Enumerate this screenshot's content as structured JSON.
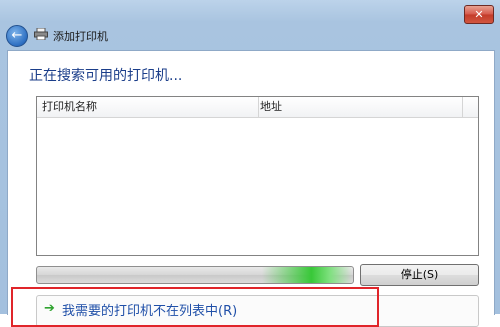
{
  "window": {
    "title": "添加打印机",
    "close_glyph": "✕"
  },
  "nav": {
    "back_glyph": "←"
  },
  "main": {
    "heading": "正在搜索可用的打印机..."
  },
  "list": {
    "columns": [
      "打印机名称",
      "地址"
    ],
    "rows": []
  },
  "search": {
    "progress_indeterminate": true,
    "stop_label": "停止(S)"
  },
  "footer": {
    "missing_link": "我需要的打印机不在列表中(R)",
    "arrow_glyph": "➔"
  },
  "colors": {
    "accent": "#1b3e8a",
    "progress_glow": "#38c838",
    "highlight": "#e0252a"
  }
}
